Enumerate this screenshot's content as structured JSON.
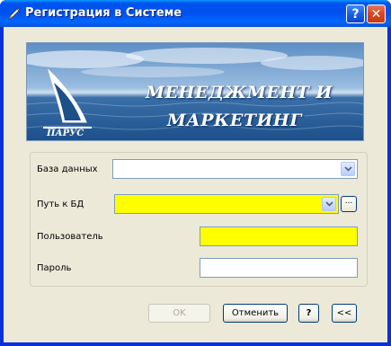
{
  "window": {
    "title": "Регистрация в Системе",
    "help_label": "?",
    "close_label": "✕"
  },
  "banner": {
    "line1": "МЕНЕДЖМЕНТ И",
    "line2": "МАРКЕТИНГ",
    "logo_text": "ПАРУС"
  },
  "form": {
    "database_label": "База данных",
    "database_value": "",
    "db_path_label": "Путь к БД",
    "db_path_value": "",
    "user_label": "Пользователь",
    "user_value": "",
    "password_label": "Пароль",
    "password_value": "",
    "browse_label": "..."
  },
  "buttons": {
    "ok": "OK",
    "cancel": "Отменить",
    "help": "?",
    "collapse": "<<"
  },
  "colors": {
    "required_field": "#ffff00",
    "titlebar": "#0054e3"
  }
}
